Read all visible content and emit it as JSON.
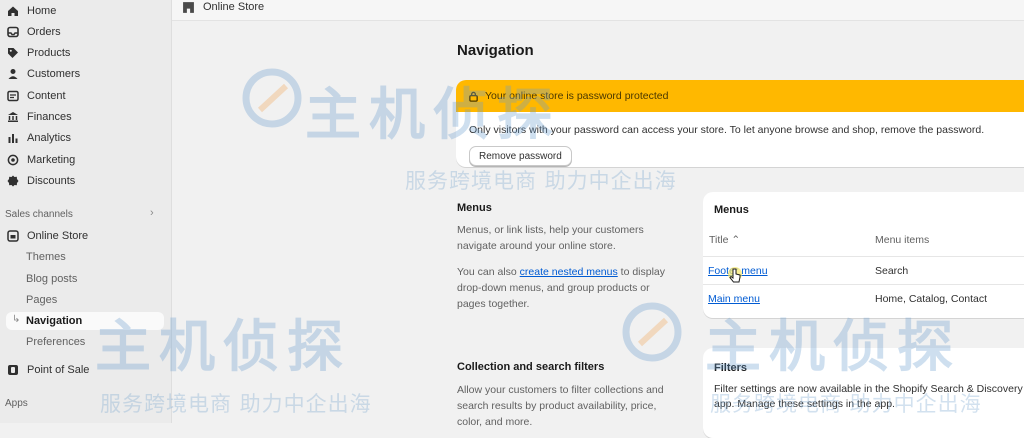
{
  "sidebar": {
    "items": [
      {
        "label": "Home",
        "icon": "home-icon"
      },
      {
        "label": "Orders",
        "icon": "inbox-icon"
      },
      {
        "label": "Products",
        "icon": "tag-icon"
      },
      {
        "label": "Customers",
        "icon": "person-icon"
      },
      {
        "label": "Content",
        "icon": "content-icon"
      },
      {
        "label": "Finances",
        "icon": "bank-icon"
      },
      {
        "label": "Analytics",
        "icon": "bar-chart-icon"
      },
      {
        "label": "Marketing",
        "icon": "target-icon"
      },
      {
        "label": "Discounts",
        "icon": "discount-icon"
      }
    ],
    "sales_channels_label": "Sales channels",
    "online_store": {
      "label": "Online Store",
      "icon": "store-icon"
    },
    "sub_items": [
      "Themes",
      "Blog posts",
      "Pages",
      "Navigation",
      "Preferences"
    ],
    "point_of_sale": {
      "label": "Point of Sale",
      "icon": "pos-icon"
    },
    "apps_label": "Apps"
  },
  "topbar": {
    "breadcrumb": "Online Store",
    "icon": "store-icon"
  },
  "page": {
    "title": "Navigation"
  },
  "banner": {
    "heading": "Your online store is password protected",
    "text": "Only visitors with your password can access your store. To let anyone browse and shop, remove the password.",
    "button": "Remove password",
    "color": "#ffb800"
  },
  "menus_section": {
    "title": "Menus",
    "desc1": "Menus, or link lists, help your customers navigate around your online store.",
    "desc2_prefix": "You can also ",
    "desc2_link": "create nested menus",
    "desc2_suffix": " to display drop-down menus, and group products or pages together."
  },
  "menus_card": {
    "title": "Menus",
    "col_title": "Title",
    "col_items": "Menu items",
    "rows": [
      {
        "title": "Footer menu",
        "items": "Search"
      },
      {
        "title": "Main menu",
        "items": "Home, Catalog, Contact"
      }
    ]
  },
  "filters_section": {
    "title": "Collection and search filters",
    "desc": "Allow your customers to filter collections and search results by product availability, price, color, and more."
  },
  "filters_card": {
    "title": "Filters",
    "text": "Filter settings are now available in the Shopify Search & Discovery app. Manage these settings in the app."
  },
  "watermark": {
    "brand": "主机侦探",
    "tagline": "服务跨境电商 助力中企出海"
  },
  "colors": {
    "link": "#005bd3",
    "accent": "#ffb800"
  }
}
